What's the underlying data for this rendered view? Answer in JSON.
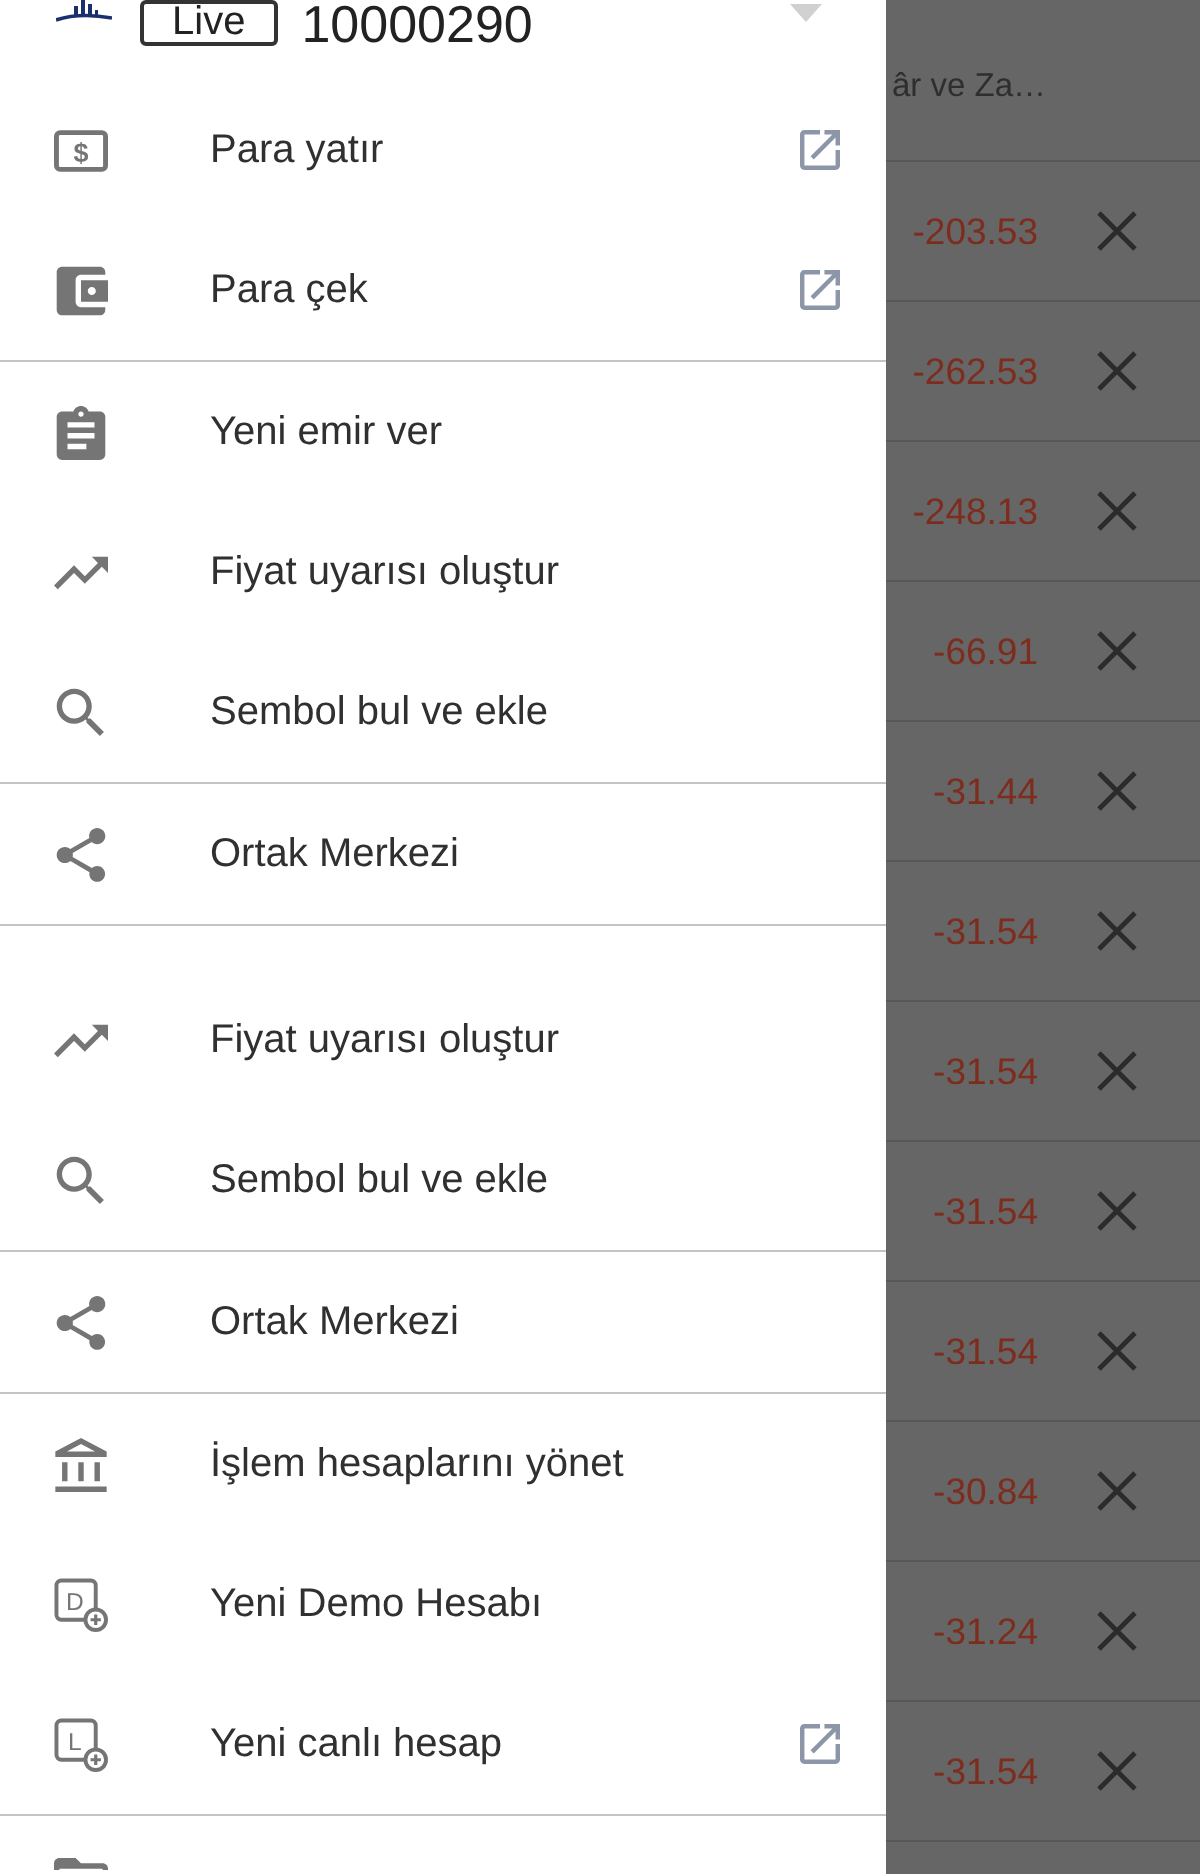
{
  "header": {
    "badge": "Live",
    "account": "10000290"
  },
  "menu": {
    "sections": [
      {
        "items": [
          {
            "kind": "dollar",
            "icon_letter": "$",
            "label": "Para yatır",
            "external": true
          },
          {
            "kind": "wallet",
            "label": "Para çek",
            "external": true
          }
        ]
      },
      {
        "items": [
          {
            "kind": "clipboard",
            "label": "Yeni emir ver",
            "external": false
          },
          {
            "kind": "trending",
            "label": "Fiyat uyarısı oluştur",
            "external": false
          },
          {
            "kind": "search",
            "label": "Sembol bul ve ekle",
            "external": false
          }
        ]
      },
      {
        "items": [
          {
            "kind": "share",
            "label": "Ortak Merkezi",
            "external": false
          }
        ]
      },
      {
        "items": [
          {
            "kind": "trending",
            "label": "Fiyat uyarısı oluştur",
            "external": false
          },
          {
            "kind": "search",
            "label": "Sembol bul ve ekle",
            "external": false
          }
        ]
      },
      {
        "items": [
          {
            "kind": "share",
            "label": "Ortak Merkezi",
            "external": false
          }
        ]
      },
      {
        "items": [
          {
            "kind": "bank",
            "label": "İşlem hesaplarını yönet",
            "external": false
          },
          {
            "kind": "account_plus",
            "icon_letter": "D",
            "label": "Yeni Demo Hesabı",
            "external": false
          },
          {
            "kind": "account_plus",
            "icon_letter": "L",
            "label": "Yeni canlı hesap",
            "external": true
          }
        ]
      },
      {
        "items": [
          {
            "kind": "folder"
          }
        ]
      }
    ]
  },
  "positions": {
    "column_header": "âr ve Za…",
    "rows": [
      {
        "value": "-203.53"
      },
      {
        "value": "-262.53"
      },
      {
        "value": "-248.13"
      },
      {
        "value": "-66.91"
      },
      {
        "value": "-31.44"
      },
      {
        "value": "-31.54"
      },
      {
        "value": "-31.54"
      },
      {
        "value": "-31.54"
      },
      {
        "value": "-31.54"
      },
      {
        "value": "-30.84"
      },
      {
        "value": "-31.24"
      },
      {
        "value": "-31.54"
      }
    ]
  }
}
